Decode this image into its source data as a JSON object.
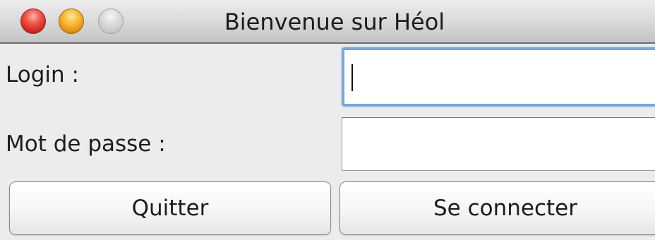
{
  "window": {
    "title": "Bienvenue sur Héol"
  },
  "form": {
    "login_label": "Login :",
    "login_value": "",
    "password_label": "Mot de passe :",
    "password_value": ""
  },
  "buttons": {
    "quit_label": "Quitter",
    "connect_label": "Se connecter"
  }
}
